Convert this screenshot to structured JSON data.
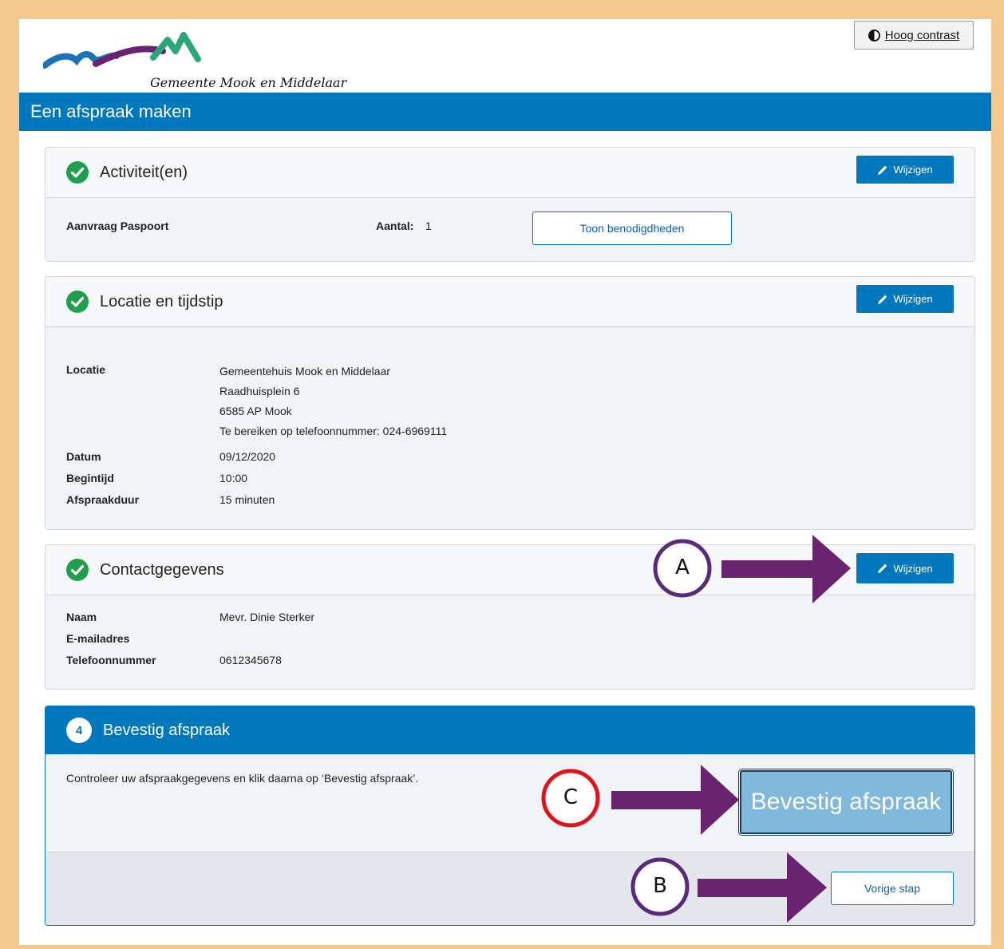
{
  "logo": {
    "text": "Gemeente Mook en Middelaar"
  },
  "contrast_button": {
    "label": "Hoog contrast"
  },
  "page_title": "Een afspraak maken",
  "edit_label": "Wijzigen",
  "sections": {
    "activities": {
      "title": "Activiteit(en)",
      "item": "Aanvraag Paspoort",
      "count_label": "Aantal:",
      "count_value": "1",
      "needs_button": "Toon benodigdheden"
    },
    "location": {
      "title": "Locatie en tijdstip",
      "location_label": "Locatie",
      "location_lines": [
        "Gemeentehuis Mook en Middelaar",
        "Raadhuisplein 6",
        "6585 AP Mook",
        "Te bereiken op telefoonnummer: 024-6969111"
      ],
      "date_label": "Datum",
      "date_value": "09/12/2020",
      "start_label": "Begintijd",
      "start_value": "10:00",
      "duration_label": "Afspraakduur",
      "duration_value": "15 minuten"
    },
    "contact": {
      "title": "Contactgegevens",
      "name_label": "Naam",
      "name_value": "Mevr. Dinie Sterker",
      "email_label": "E-mailadres",
      "email_value": "",
      "phone_label": "Telefoonnummer",
      "phone_value": "0612345678"
    },
    "confirm": {
      "step_number": "4",
      "title": "Bevestig afspraak",
      "instruction": "Controleer uw afspraakgegevens en klik daarna op ‘Bevestig afspraak’.",
      "confirm_button": "Bevestig afspraak",
      "previous_button": "Vorige stap"
    }
  },
  "annotations": {
    "a": "A",
    "b": "B",
    "c": "C"
  },
  "colors": {
    "brand_blue": "#0078be",
    "success_green": "#1f9e4b",
    "frame_orange": "#f5c890",
    "arrow_purple": "#6a2370",
    "circle_purple": "#5a2a7a",
    "circle_red": "#e0121c"
  }
}
